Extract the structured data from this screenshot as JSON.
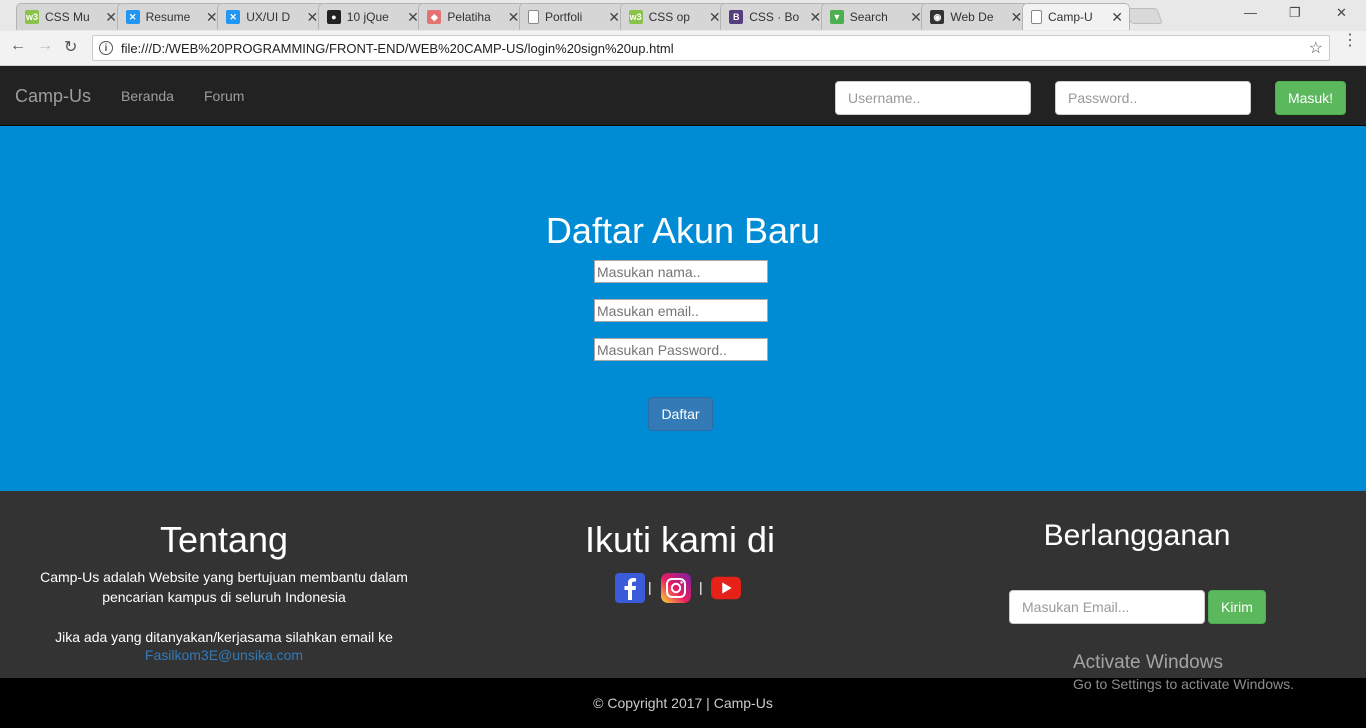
{
  "browser": {
    "tabs": [
      {
        "label": "CSS Mu",
        "favicon": "w3schools-icon",
        "color": "#8bc34a",
        "glyph": "w3",
        "active": false
      },
      {
        "label": "Resume",
        "favicon": "x-logo-icon",
        "color": "#2196f3",
        "glyph": "✕",
        "active": false
      },
      {
        "label": "UX/UI D",
        "favicon": "x-logo-icon",
        "color": "#2196f3",
        "glyph": "✕",
        "active": false
      },
      {
        "label": "10 jQue",
        "favicon": "github-icon",
        "color": "#222222",
        "glyph": "●",
        "active": false
      },
      {
        "label": "Pelatiha",
        "favicon": "cube-icon",
        "color": "#e57373",
        "glyph": "◆",
        "active": false
      },
      {
        "label": "Portfoli",
        "favicon": "document-icon",
        "color": "#ffffff",
        "glyph": "",
        "active": false
      },
      {
        "label": "CSS op",
        "favicon": "w3schools-icon",
        "color": "#8bc34a",
        "glyph": "w3",
        "active": false
      },
      {
        "label": "CSS · Bo",
        "favicon": "bootstrap-icon",
        "color": "#563d7c",
        "glyph": "B",
        "active": false
      },
      {
        "label": "Search",
        "favicon": "funnel-icon",
        "color": "#4caf50",
        "glyph": "▼",
        "active": false
      },
      {
        "label": "Web De",
        "favicon": "camera-icon",
        "color": "#333333",
        "glyph": "◉",
        "active": false
      },
      {
        "label": "Camp-U",
        "favicon": "document-icon",
        "color": "#ffffff",
        "glyph": "",
        "active": true
      }
    ],
    "close_glyph": "✕",
    "url": "file:///D:/WEB%20PROGRAMMING/FRONT-END/WEB%20CAMP-US/login%20sign%20up.html",
    "info_glyph": "i",
    "back_glyph": "←",
    "forward_glyph": "→",
    "reload_glyph": "↻",
    "star_glyph": "☆",
    "menu_glyph": "⋮",
    "minimize_glyph": "—",
    "restore_glyph": "❐",
    "window_close_glyph": "✕"
  },
  "navbar": {
    "brand": "Camp-Us",
    "links": [
      "Beranda",
      "Forum"
    ],
    "username_placeholder": "Username..",
    "password_placeholder": "Password..",
    "login_button": "Masuk!"
  },
  "hero": {
    "title": "Daftar Akun Baru",
    "name_placeholder": "Masukan nama..",
    "email_placeholder": "Masukan email..",
    "password_placeholder": "Masukan Password..",
    "submit_button": "Daftar",
    "background_color": "#008cd5"
  },
  "footer": {
    "about": {
      "heading": "Tentang",
      "line1": "Camp-Us adalah Website yang bertujuan membantu dalam",
      "line2": "pencarian kampus di seluruh Indonesia",
      "line3": "Jika ada yang ditanyakan/kerjasama silahkan email ke",
      "email": "Fasilkom3E@unsika.com"
    },
    "follow": {
      "heading": "Ikuti kami di",
      "separator": "|",
      "icons": [
        "facebook-icon",
        "instagram-icon",
        "youtube-icon"
      ]
    },
    "subscribe": {
      "heading": "Berlangganan",
      "email_placeholder": "Masukan Email...",
      "button": "Kirim"
    },
    "copyright": "© Copyright 2017 | Camp-Us"
  },
  "watermark": {
    "line1": "Activate Windows",
    "line2": "Go to Settings to activate Windows."
  }
}
